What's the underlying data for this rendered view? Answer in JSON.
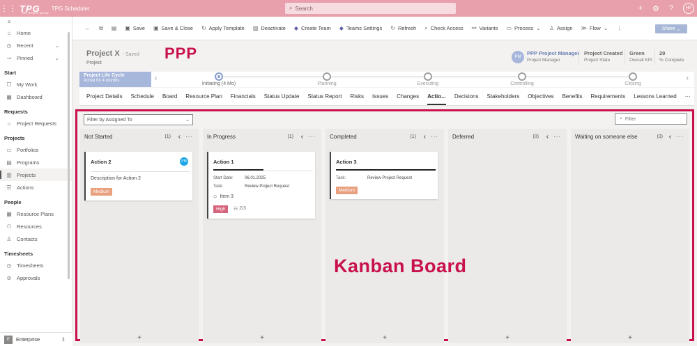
{
  "topbar": {
    "logo": "TPG",
    "logo_sub": "the project group",
    "app_name": "TPG Scheduler",
    "search_placeholder": "Search",
    "avatar": "HP"
  },
  "sidebar": {
    "items": [
      {
        "label": "Home"
      },
      {
        "label": "Recent"
      },
      {
        "label": "Pinned"
      }
    ],
    "groups": [
      {
        "title": "Start",
        "items": [
          "My Work",
          "Dashboard"
        ]
      },
      {
        "title": "Requests",
        "items": [
          "Project Requests"
        ]
      },
      {
        "title": "Projects",
        "items": [
          "Portfolios",
          "Programs",
          "Projects",
          "Actions"
        ]
      },
      {
        "title": "People",
        "items": [
          "Resource Plans",
          "Resources",
          "Contacts"
        ]
      },
      {
        "title": "Timesheets",
        "items": [
          "Timesheets",
          "Approvals"
        ]
      }
    ],
    "area_badge": "E",
    "area": "Enterprise"
  },
  "commands": [
    "Save",
    "Save & Close",
    "Apply Template",
    "Deactivate",
    "Create Team",
    "Teams Settings",
    "Refresh",
    "Check Access",
    "Variants",
    "Process",
    "Assign",
    "Flow"
  ],
  "share_label": "Share",
  "header": {
    "title": "Project X",
    "saved": "- Saved",
    "type": "Project",
    "overlay": "PPP",
    "owner_initials": "PM",
    "owner_name": "PPP Project Manager",
    "owner_role": "Project Manager",
    "state_value": "Project Created",
    "state_label": "Project State",
    "kpi_value": "Green",
    "kpi_label": "Overall KPI",
    "complete_value": "29",
    "complete_label": "% Complete"
  },
  "lifecycle": {
    "title": "Project Life Cycle",
    "sub": "Active for 4 months",
    "stages": [
      {
        "label": "Initiating  (4 Mo)",
        "active": true
      },
      {
        "label": "Planning",
        "active": false
      },
      {
        "label": "Executing",
        "active": false
      },
      {
        "label": "Controlling",
        "active": false
      },
      {
        "label": "Closing",
        "active": false
      }
    ]
  },
  "tabs": [
    "Project Details",
    "Schedule",
    "Board",
    "Resource Plan",
    "Financials",
    "Status Update",
    "Status Report",
    "Risks",
    "Issues",
    "Changes",
    "Actio...",
    "Decisions",
    "Stakeholders",
    "Objectives",
    "Benefits",
    "Requirements",
    "Lessons Learned",
    "···"
  ],
  "board": {
    "filter_assigned": "Filter by Assigned To",
    "filter_placeholder": "Filter",
    "overlay": "Kanban Board",
    "columns": [
      {
        "title": "Not Started",
        "count": "(1)"
      },
      {
        "title": "In Progress",
        "count": "(1)"
      },
      {
        "title": "Completed",
        "count": "(1)"
      },
      {
        "title": "Deferred",
        "count": "(0)"
      },
      {
        "title": "Waiting on someone else",
        "count": "(0)"
      }
    ],
    "cards": {
      "a2": {
        "title": "Action 2",
        "avatar": "PM",
        "desc": "Description for Action 2",
        "priority": "Medium"
      },
      "a1": {
        "title": "Action 1",
        "start_k": "Start Date:",
        "start_v": "06.01.2025",
        "task_k": "Task:",
        "task_v": "Review Project Request",
        "item": "Item 3",
        "priority": "High",
        "checklist": "2/3"
      },
      "a3": {
        "title": "Action 3",
        "task_k": "Task:",
        "task_v": "Review Project Request",
        "priority": "Medium"
      }
    }
  }
}
